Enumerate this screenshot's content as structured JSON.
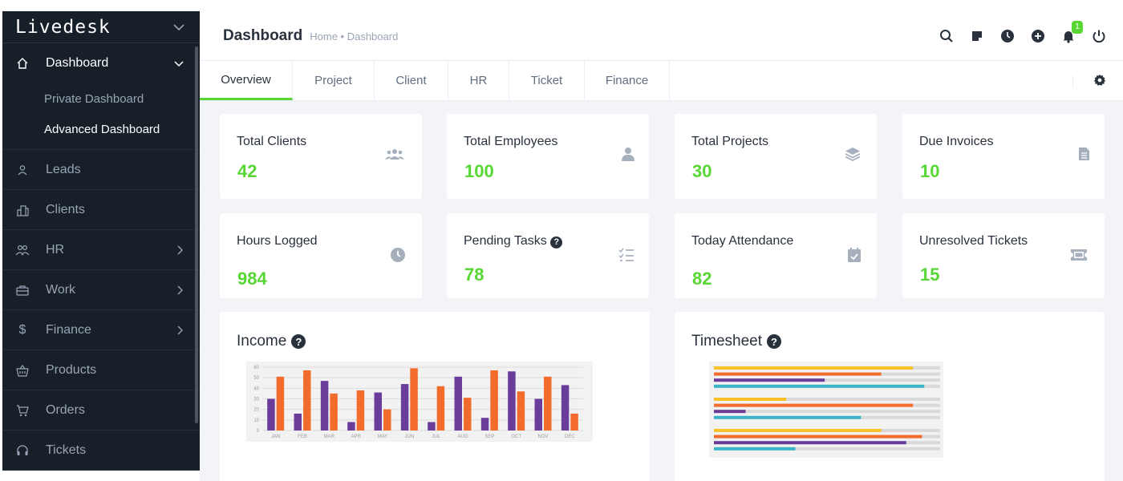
{
  "app": {
    "brand": "Livedesk"
  },
  "sidebar": {
    "dashboard": {
      "label": "Dashboard",
      "sub": [
        "Private Dashboard",
        "Advanced Dashboard"
      ]
    },
    "items": [
      {
        "label": "Leads",
        "icon": "person-icon"
      },
      {
        "label": "Clients",
        "icon": "building-icon"
      },
      {
        "label": "HR",
        "icon": "people-icon",
        "has_children": true
      },
      {
        "label": "Work",
        "icon": "briefcase-icon",
        "has_children": true
      },
      {
        "label": "Finance",
        "icon": "dollar-icon",
        "has_children": true
      },
      {
        "label": "Products",
        "icon": "basket-icon"
      },
      {
        "label": "Orders",
        "icon": "cart-icon"
      },
      {
        "label": "Tickets",
        "icon": "headset-icon"
      }
    ]
  },
  "header": {
    "title": "Dashboard",
    "breadcrumb": "Home • Dashboard",
    "notification_count": "1"
  },
  "tabs": [
    "Overview",
    "Project",
    "Client",
    "HR",
    "Ticket",
    "Finance"
  ],
  "stats": [
    {
      "title": "Total Clients",
      "value": "42",
      "icon": "users-icon"
    },
    {
      "title": "Total Employees",
      "value": "100",
      "icon": "user-icon"
    },
    {
      "title": "Total Projects",
      "value": "30",
      "icon": "layers-icon"
    },
    {
      "title": "Due Invoices",
      "value": "10",
      "icon": "invoice-icon"
    },
    {
      "title": "Hours Logged",
      "value": "984",
      "icon": "clock-icon"
    },
    {
      "title": "Pending Tasks",
      "value": "78",
      "icon": "task-list-icon"
    },
    {
      "title": "Today Attendance",
      "value": "82",
      "icon": "calendar-check-icon"
    },
    {
      "title": "Unresolved Tickets",
      "value": "15",
      "icon": "ticket-icon"
    }
  ],
  "panels": {
    "income": {
      "title": "Income"
    },
    "timesheet": {
      "title": "Timesheet"
    }
  },
  "chart_data": [
    {
      "type": "bar",
      "categories": [
        "JAN",
        "FEB",
        "MAR",
        "APR",
        "MAY",
        "JUN",
        "JUL",
        "AUG",
        "SEP",
        "OCT",
        "NOV",
        "DEC"
      ],
      "series": [
        {
          "values": [
            30,
            16,
            47,
            8,
            36,
            44,
            8,
            51,
            12,
            56,
            30,
            43
          ]
        },
        {
          "values": [
            51,
            57,
            35,
            38,
            20,
            59,
            42,
            31,
            57,
            37,
            51,
            16
          ]
        }
      ],
      "ylim": [
        0,
        60
      ],
      "yticks": [
        "0",
        "10",
        "20",
        "30",
        "40",
        "50",
        "60"
      ],
      "grid": true
    },
    {
      "type": "bar",
      "orientation": "horizontal",
      "groups": [
        {
          "values": [
            0.88,
            0.74,
            0.49,
            0.93
          ]
        },
        {
          "values": [
            0.32,
            0.88,
            0.14,
            0.65
          ]
        },
        {
          "values": [
            0.74,
            0.92,
            0.85,
            0.36
          ]
        }
      ],
      "xlim": [
        0,
        1
      ]
    }
  ],
  "colors": {
    "accent": "#58d633",
    "sidebar_bg": "#171f29",
    "purple": "#6a3d9a",
    "orange": "#f36c2b",
    "yellow": "#f9c22b",
    "teal": "#3ab4c6",
    "track": "#d9d9d9"
  }
}
